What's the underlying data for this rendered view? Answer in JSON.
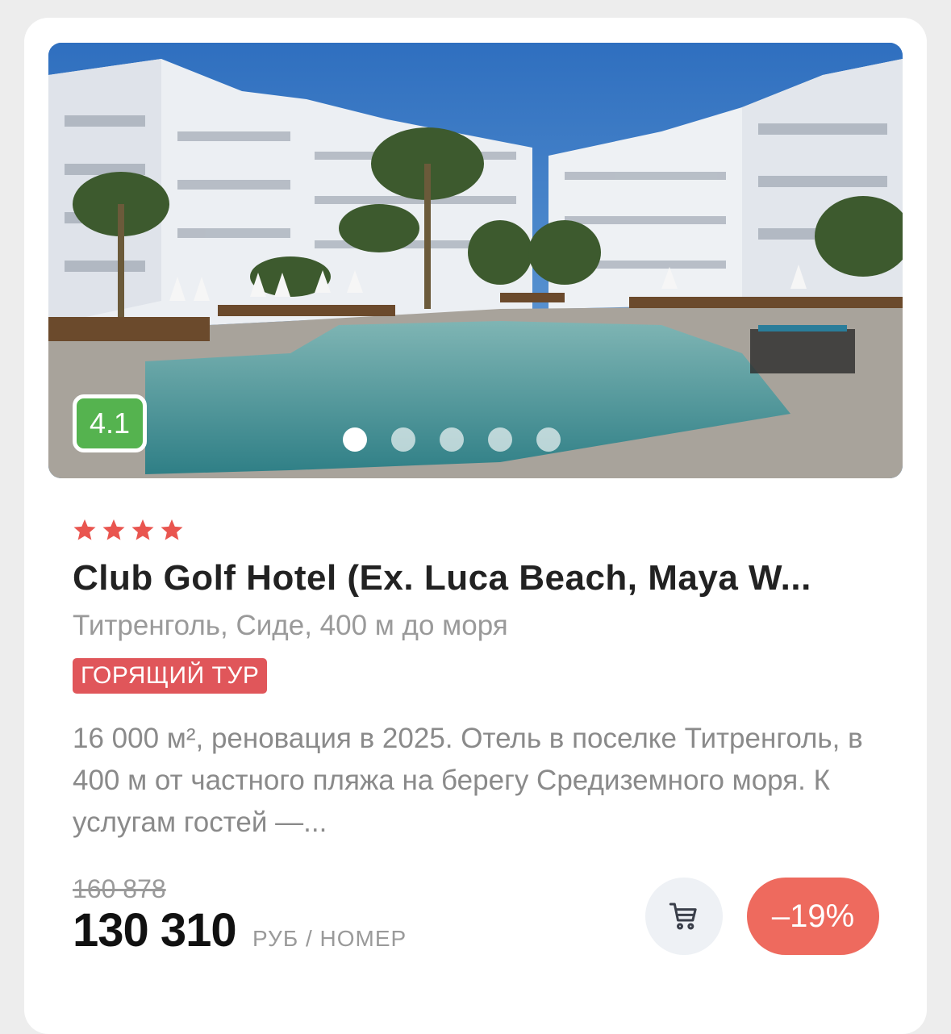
{
  "hotel": {
    "rating": "4.1",
    "stars": 4,
    "star_color": "#e9554f",
    "name": "Club Golf Hotel (Ex. Luca Beach, Maya W...",
    "location": "Титренголь, Сиде, 400 м до моря",
    "badge": "ГОРЯЩИЙ ТУР",
    "description": "16 000 м², реновация в 2025. Отель в поселке Титренголь, в 400 м от частного пляжа на берегу Средиземного моря. К услугам гостей —..."
  },
  "gallery": {
    "photo_count": 5,
    "active_index": 0
  },
  "pricing": {
    "old_price": "160 878",
    "price": "130 310",
    "unit": "РУБ / НОМЕР",
    "discount": "–19%",
    "discount_color": "#ee6a5e"
  },
  "icons": {
    "cart": "cart-icon",
    "star": "star-icon"
  }
}
